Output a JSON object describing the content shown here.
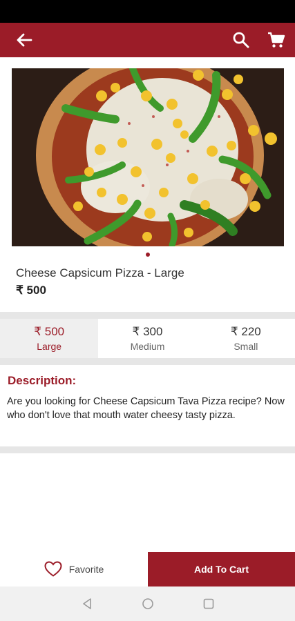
{
  "header": {
    "back_icon": "arrow-left-icon",
    "search_icon": "search-icon",
    "cart_icon": "cart-icon",
    "bar_color": "#9b1c28"
  },
  "product": {
    "image": "pizza-photo",
    "name": "Cheese Capsicum Pizza - Large",
    "price": "₹ 500",
    "carousel_position": 1,
    "carousel_count": 1
  },
  "sizes": [
    {
      "price": "₹ 500",
      "label": "Large",
      "selected": true
    },
    {
      "price": "₹ 300",
      "label": "Medium",
      "selected": false
    },
    {
      "price": "₹ 220",
      "label": "Small",
      "selected": false
    }
  ],
  "description": {
    "title": "Description:",
    "text": "Are you looking for Cheese Capsicum Tava Pizza recipe? Now who don't love that mouth water cheesy tasty pizza."
  },
  "actions": {
    "favorite_label": "Favorite",
    "favorite_icon": "heart-icon",
    "add_to_cart_label": "Add To Cart"
  },
  "system_nav": {
    "back": "triangle-back-icon",
    "home": "circle-home-icon",
    "recents": "square-recents-icon"
  },
  "colors": {
    "accent": "#9b1c28",
    "selected_bg": "#efefef",
    "divider": "#e6e6e6"
  }
}
